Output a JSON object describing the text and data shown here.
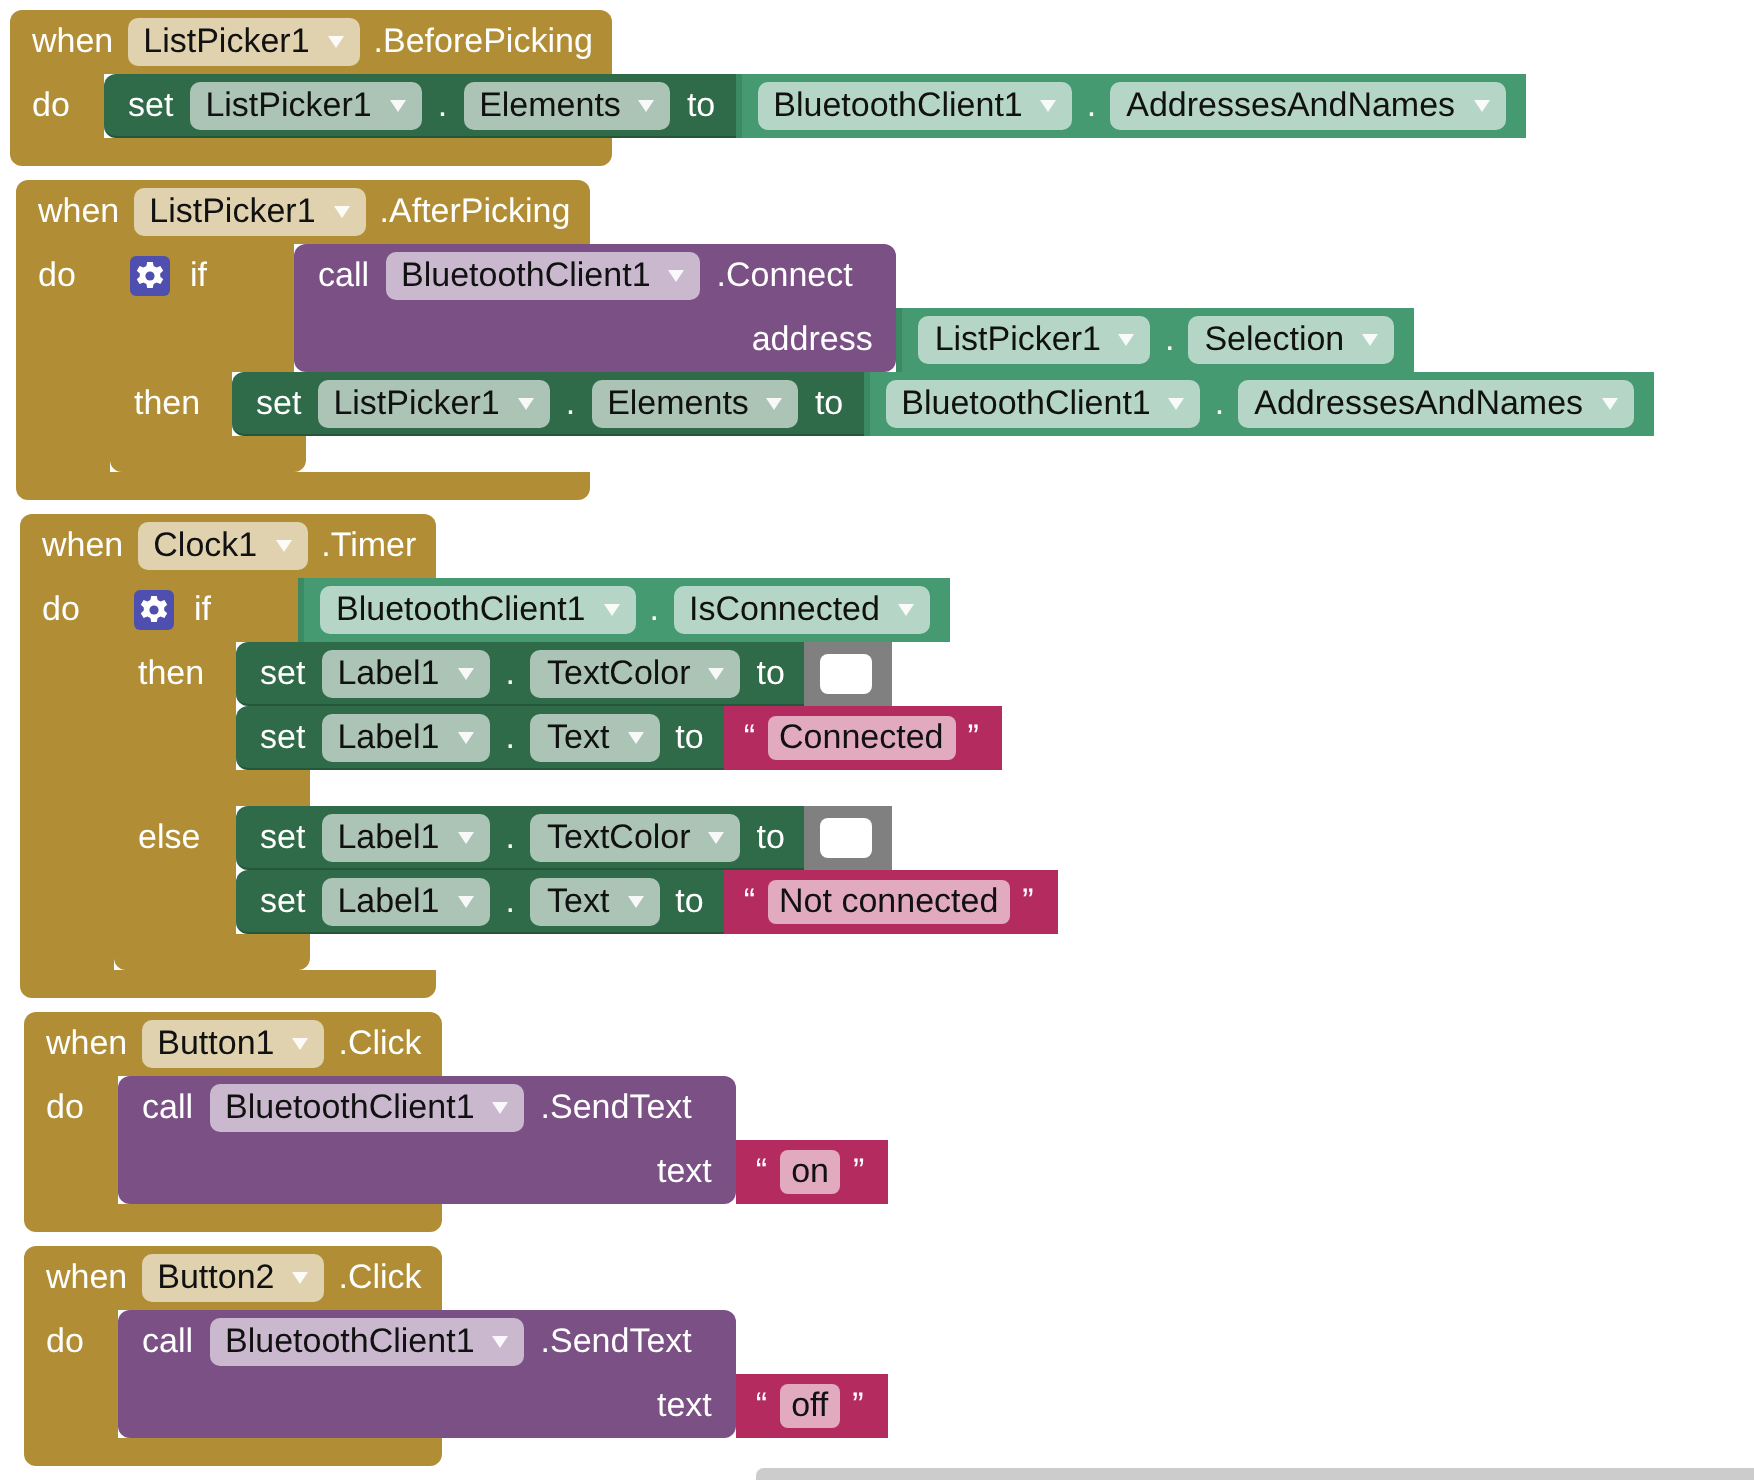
{
  "blocks": [
    {
      "kind": "event",
      "when": "when",
      "component": "ListPicker1",
      "event": ".BeforePicking",
      "do": "do",
      "body": [
        {
          "kind": "set",
          "set": "set",
          "component": "ListPicker1",
          "dot": ".",
          "property": "Elements",
          "to": "to",
          "value": {
            "kind": "getter",
            "component": "BluetoothClient1",
            "dot": ".",
            "property": "AddressesAndNames"
          }
        }
      ]
    },
    {
      "kind": "event",
      "when": "when",
      "component": "ListPicker1",
      "event": ".AfterPicking",
      "do": "do",
      "body": [
        {
          "kind": "if",
          "if": "if",
          "condition": {
            "kind": "call",
            "call": "call",
            "component": "BluetoothClient1",
            "method": ".Connect",
            "args": [
              {
                "name": "address",
                "value": {
                  "kind": "getter",
                  "component": "ListPicker1",
                  "dot": ".",
                  "property": "Selection"
                }
              }
            ]
          },
          "branches": [
            {
              "label": "then",
              "body": [
                {
                  "kind": "set",
                  "set": "set",
                  "component": "ListPicker1",
                  "dot": ".",
                  "property": "Elements",
                  "to": "to",
                  "value": {
                    "kind": "getter",
                    "component": "BluetoothClient1",
                    "dot": ".",
                    "property": "AddressesAndNames"
                  }
                }
              ]
            }
          ]
        }
      ]
    },
    {
      "kind": "event",
      "when": "when",
      "component": "Clock1",
      "event": ".Timer",
      "do": "do",
      "body": [
        {
          "kind": "if",
          "if": "if",
          "condition": {
            "kind": "getter",
            "component": "BluetoothClient1",
            "dot": ".",
            "property": "IsConnected"
          },
          "branches": [
            {
              "label": "then",
              "body": [
                {
                  "kind": "set",
                  "set": "set",
                  "component": "Label1",
                  "dot": ".",
                  "property": "TextColor",
                  "to": "to",
                  "value": {
                    "kind": "color",
                    "color": "#ffffff"
                  }
                },
                {
                  "kind": "set",
                  "set": "set",
                  "component": "Label1",
                  "dot": ".",
                  "property": "Text",
                  "to": "to",
                  "value": {
                    "kind": "text",
                    "open": "“",
                    "value": "Connected",
                    "close": "”"
                  }
                }
              ]
            },
            {
              "label": "else",
              "body": [
                {
                  "kind": "set",
                  "set": "set",
                  "component": "Label1",
                  "dot": ".",
                  "property": "TextColor",
                  "to": "to",
                  "value": {
                    "kind": "color",
                    "color": "#ffffff"
                  }
                },
                {
                  "kind": "set",
                  "set": "set",
                  "component": "Label1",
                  "dot": ".",
                  "property": "Text",
                  "to": "to",
                  "value": {
                    "kind": "text",
                    "open": "“",
                    "value": "Not connected",
                    "close": "”"
                  }
                }
              ]
            }
          ]
        }
      ]
    },
    {
      "kind": "event",
      "when": "when",
      "component": "Button1",
      "event": ".Click",
      "do": "do",
      "body": [
        {
          "kind": "call",
          "call": "call",
          "component": "BluetoothClient1",
          "method": ".SendText",
          "args": [
            {
              "name": "text",
              "value": {
                "kind": "text",
                "open": "“",
                "value": "on",
                "close": "”"
              }
            }
          ]
        }
      ]
    },
    {
      "kind": "event",
      "when": "when",
      "component": "Button2",
      "event": ".Click",
      "do": "do",
      "body": [
        {
          "kind": "call",
          "call": "call",
          "component": "BluetoothClient1",
          "method": ".SendText",
          "args": [
            {
              "name": "text",
              "value": {
                "kind": "text",
                "open": "“",
                "value": "off",
                "close": "”"
              }
            }
          ]
        }
      ]
    }
  ]
}
